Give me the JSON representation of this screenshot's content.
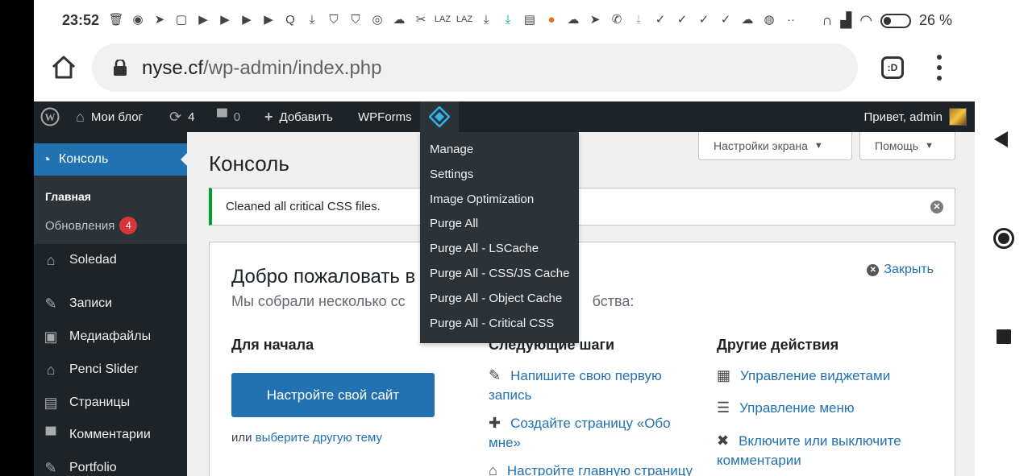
{
  "status_bar": {
    "time": "23:52",
    "battery": "26 %",
    "icons": [
      "delete-icon",
      "discord-icon",
      "telegram-icon",
      "calendar-icon",
      "youtube-icon",
      "youtube-icon",
      "youtube-icon",
      "youtube-icon",
      "search-app-icon",
      "download-icon",
      "shield-icon",
      "shield-icon",
      "instagram-icon",
      "cloud-icon",
      "scissors-icon",
      "laz-icon",
      "laz-icon",
      "download-icon",
      "download-icon",
      "gallery-icon",
      "app-icon",
      "cloud-upload-icon",
      "telegram-icon",
      "viber-icon",
      "download-icon",
      "check-icon",
      "check-icon",
      "check-icon",
      "check-icon",
      "cloud-icon",
      "chrome-icon",
      "more-icon"
    ],
    "icon_text_laz": "LAZ"
  },
  "browser": {
    "url_host": "nyse.cf",
    "url_path": "/wp-admin/index.php",
    "tab_label": ":D"
  },
  "admin_bar": {
    "site_name": "Мои блог",
    "updates_count": "4",
    "comments_count": "0",
    "add_new": "Добавить",
    "wpforms": "WPForms",
    "greeting": "Привет, admin"
  },
  "litespeed_menu": {
    "items": [
      "Manage",
      "Settings",
      "Image Optimization",
      "Purge All",
      "Purge All - LSCache",
      "Purge All - CSS/JS Cache",
      "Purge All - Object Cache",
      "Purge All - Critical CSS"
    ]
  },
  "sidebar": {
    "current": "Консоль",
    "submenu": {
      "home": "Главная",
      "updates": "Обновления",
      "updates_badge": "4"
    },
    "items": [
      "Soledad",
      "Записи",
      "Медиафайлы",
      "Penci Slider",
      "Страницы",
      "Комментарии",
      "Portfolio"
    ]
  },
  "main": {
    "screen_options": "Настройки экрана",
    "help": "Помощь",
    "page_title": "Консоль",
    "notice": "Cleaned all critical CSS files.",
    "welcome": {
      "title": "Добро пожаловать в",
      "subtitle_left": "Мы собрали несколько сс",
      "subtitle_right": "бства:",
      "close": "Закрыть",
      "col1_title": "Для начала",
      "cta": "Настройте свой сайт",
      "alt_prefix": "или",
      "alt_link": "выберите другую тему",
      "col2_title": "Следующие шаги",
      "steps": [
        "Напишите свою первую запись",
        "Создайте страницу «Обо мне»",
        "Настройте главную страницу"
      ],
      "col3_title": "Другие действия",
      "actions": [
        "Управление виджетами",
        "Управление меню",
        "Включите или выключите комментарии"
      ]
    }
  }
}
